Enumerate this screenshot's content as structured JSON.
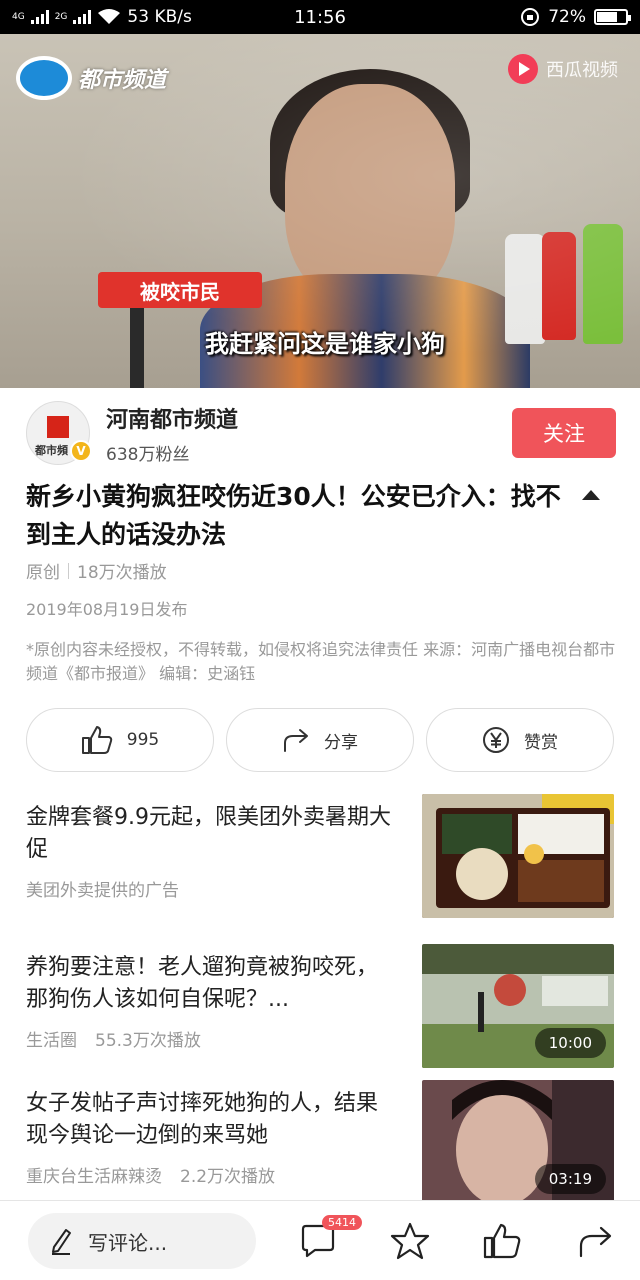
{
  "status_bar": {
    "network_4g": "4G",
    "network_2g": "2G",
    "speed": "53 KB/s",
    "time": "11:56",
    "battery": "72%",
    "battery_level": 0.72
  },
  "video": {
    "channel_logo": "都市频道",
    "platform_logo": "西瓜视频",
    "name_tag": "被咬市民",
    "subtitle": "我赶紧问这是谁家小狗",
    "progress": 0.12
  },
  "author": {
    "avatar_text": "都市頻",
    "name": "河南都市频道",
    "fans": "638万粉丝",
    "follow_label": "关注",
    "verified": "V"
  },
  "article": {
    "title": "新乡小黄狗疯狂咬伤近30人！公安已介入：找不到主人的话没办法",
    "original": "原创",
    "plays": "18万次播放",
    "date": "2019年08月19日发布",
    "notice": "*原创内容未经授权，不得转载，如侵权将追究法律责任 来源：河南广播电视台都市频道《都市报道》 编辑：史涵钰"
  },
  "actions": {
    "like_count": "995",
    "share_label": "分享",
    "reward_label": "赞赏"
  },
  "feed": [
    {
      "title": "金牌套餐9.9元起，限美团外卖暑期大促",
      "source": "美团外卖提供的广告",
      "plays": "",
      "duration": ""
    },
    {
      "title": "养狗要注意！老人遛狗竟被狗咬死，那狗伤人该如何自保呢？...",
      "source": "生活圈",
      "plays": "55.3万次播放",
      "duration": "10:00"
    },
    {
      "title": "女子发帖子声讨摔死她狗的人，结果现今舆论一边倒的来骂她",
      "source": "重庆台生活麻辣烫",
      "plays": "2.2万次播放",
      "duration": "03:19"
    }
  ],
  "bottom_bar": {
    "comment_placeholder": "写评论...",
    "comment_count": "5414"
  },
  "colors": {
    "accent": "#f0545a",
    "status_bar": "#000000"
  }
}
